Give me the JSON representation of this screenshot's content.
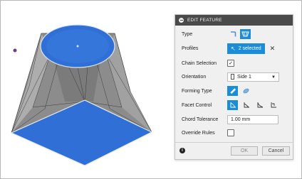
{
  "panel": {
    "title": "EDIT FEATURE",
    "type_label": "Type",
    "profiles_label": "Profiles",
    "profiles_value": "2 selected",
    "chain_selection_label": "Chain Selection",
    "chain_selection_checked": true,
    "orientation_label": "Orientation",
    "orientation_value": "Side 1",
    "forming_type_label": "Forming Type",
    "facet_control_label": "Facet Control",
    "chord_tolerance_label": "Chord Tolerance",
    "chord_tolerance_value": "1.00 mm",
    "override_rules_label": "Override Rules",
    "override_rules_checked": false,
    "ok_label": "OK",
    "cancel_label": "Cancel"
  },
  "colors": {
    "accent": "#1a8cd8",
    "header_bg": "#4a4a4a",
    "panel_bg": "#f0f0f0",
    "selected_face": "#2f6fd6",
    "model_gray": "#8a8a8a",
    "purple_marker": "#6a3c96"
  },
  "icons": {
    "header": "collapse-icon",
    "type_options": [
      "bend-type-icon",
      "loft-type-icon"
    ],
    "profiles_select": "cursor-arrow-icon",
    "clear_selection": "close-icon",
    "orientation": "side-orientation-icon",
    "forming_types": [
      "press-brake-icon",
      "die-formed-icon"
    ],
    "facet_controls": [
      "chord-tolerance-icon",
      "facet-angle-icon",
      "facet-distance-icon",
      "facet-count-icon"
    ],
    "info": "info-icon"
  }
}
